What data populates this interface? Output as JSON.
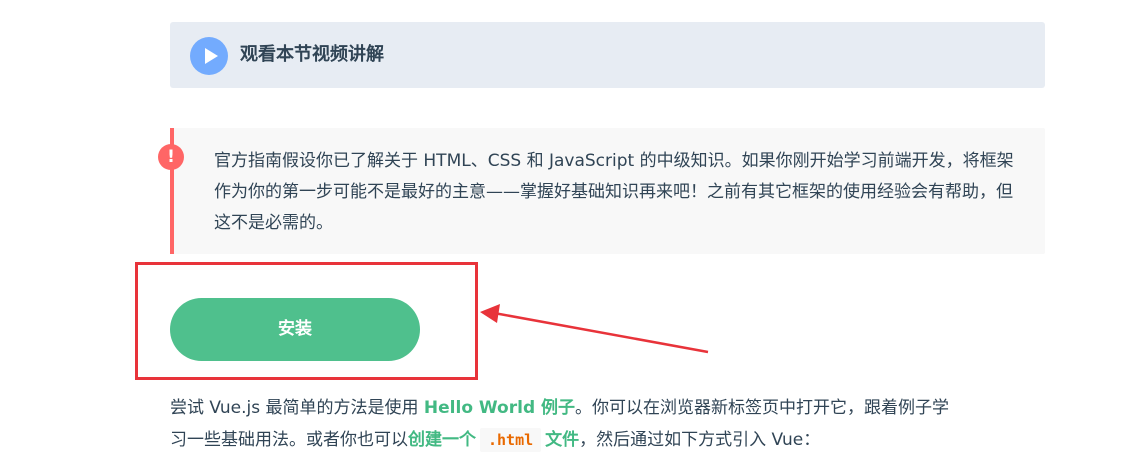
{
  "video_banner": {
    "label": "观看本节视频讲解",
    "icon": "play-icon",
    "icon_color": "#73abfe",
    "background": "#e7ecf3"
  },
  "warning": {
    "icon_text": "!",
    "icon": "warning-icon",
    "accent_color": "#ff6666",
    "text": "官方指南假设你已了解关于 HTML、CSS 和 JavaScript 的中级知识。如果你刚开始学习前端开发，将框架作为你的第一步可能不是最好的主意——掌握好基础知识再来吧！之前有其它框架的使用经验会有帮助，但这不是必需的。"
  },
  "install": {
    "label": "安装",
    "color": "#4fc08d"
  },
  "annotation": {
    "box_color": "#e8333a",
    "arrow_color": "#e8333a"
  },
  "intro": {
    "part1": "尝试 Vue.js 最简单的方法是使用 ",
    "link1": "Hello World 例子",
    "part2": "。你可以在浏览器新标签页中打开它，跟着例子学",
    "part3": "习一些基础用法。或者你也可以",
    "link2_prefix": "创建一个",
    "code": ".html",
    "link2_suffix": "文件",
    "part4": "，然后通过如下方式引入 Vue："
  }
}
